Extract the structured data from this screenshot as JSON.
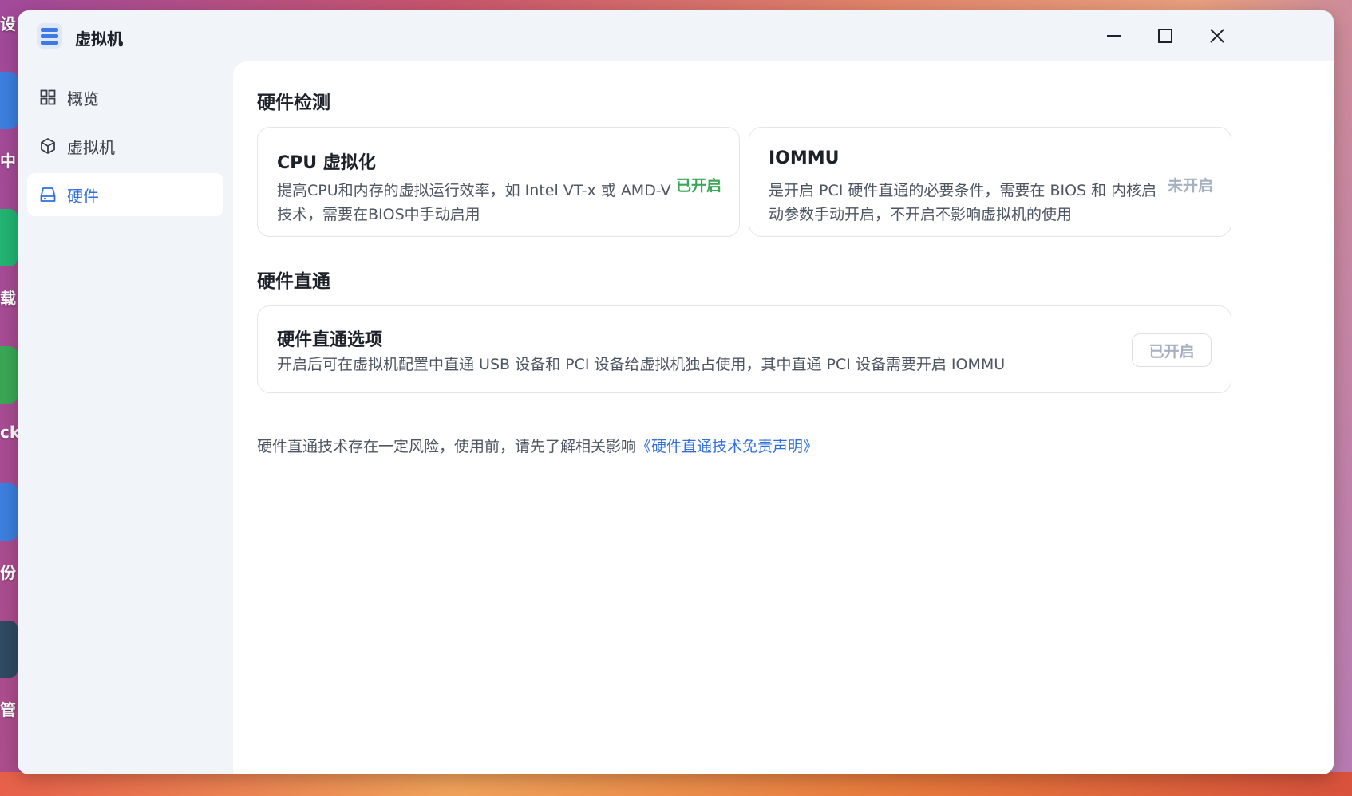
{
  "desktop": {
    "labels": [
      "设",
      "中",
      "载",
      "cke",
      "份",
      "管"
    ],
    "icon_colors": [
      "#3d7fe0",
      "#22b573",
      "#3aa856",
      "#3d7fe0",
      "#2f4a63"
    ]
  },
  "window": {
    "title": "虚拟机",
    "app_icon": "server-stack-icon"
  },
  "sidebar": {
    "items": [
      {
        "label": "概览",
        "icon": "grid-icon",
        "active": false
      },
      {
        "label": "虚拟机",
        "icon": "cube-icon",
        "active": false
      },
      {
        "label": "硬件",
        "icon": "drive-icon",
        "active": true
      }
    ]
  },
  "main": {
    "hardware_detection": {
      "title": "硬件检测",
      "cards": [
        {
          "title": "CPU 虚拟化",
          "desc_line1": "提高CPU和内存的虚拟运行效率，如 Intel VT-x 或 AMD-V",
          "desc_line2": "技术，需要在BIOS中手动启用",
          "status": "已开启",
          "status_color": "#3aa856"
        },
        {
          "title": "IOMMU",
          "desc_line1": "是开启 PCI 硬件直通的必要条件，需要在 BIOS 和 内核启",
          "desc_line2": "动参数手动开启，不开启不影响虚拟机的使用",
          "status": "未开启",
          "status_color": "#a6b0c2"
        }
      ]
    },
    "passthrough": {
      "title": "硬件直通",
      "card": {
        "title": "硬件直通选项",
        "desc": "开启后可在虚拟机配置中直通 USB 设备和 PCI 设备给虚拟机独占使用，其中直通 PCI 设备需要开启 IOMMU",
        "button_label": "已开启"
      },
      "note_text": "硬件直通技术存在一定风险，使用前，请先了解相关影响",
      "note_link": "《硬件直通技术免责声明》"
    }
  },
  "colors": {
    "accent": "#2f6fe0",
    "enabled": "#3aa856",
    "disabled": "#a6b0c2"
  }
}
